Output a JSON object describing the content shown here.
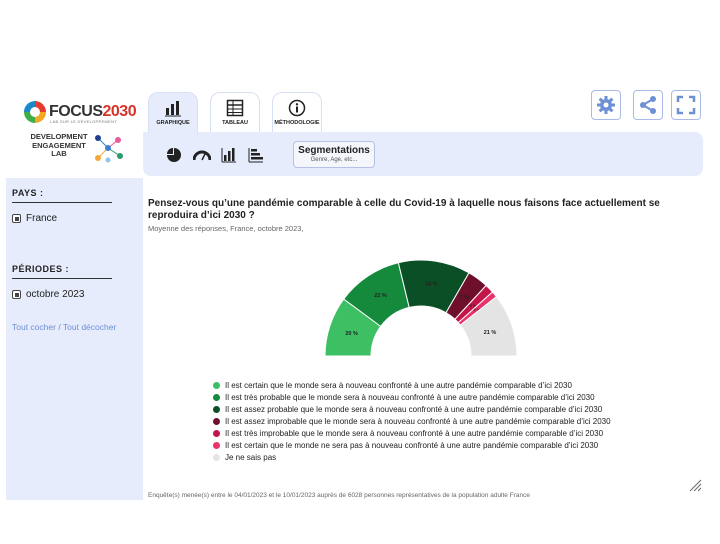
{
  "branding": {
    "focus_text": "FOCUS",
    "focus_year": "2030",
    "focus_tagline": "LAB SUR LE DÉVELOPPEMENT",
    "del_text": "DEVELOPMENT ENGAGEMENT LAB"
  },
  "tabs": [
    {
      "label": "GRAPHIQUE",
      "icon": "bar-chart-icon"
    },
    {
      "label": "TABLEAU",
      "icon": "table-icon"
    },
    {
      "label": "MÉTHODOLOGIE",
      "icon": "info-icon"
    }
  ],
  "tools": {
    "settings": "gear-icon",
    "share": "share-icon",
    "fullscreen": "fullscreen-icon"
  },
  "chart_types": [
    "pie-chart-icon",
    "gauge-icon",
    "bar-chart-icon",
    "stacked-bar-icon"
  ],
  "segmentation": {
    "title": "Segmentations",
    "subtitle": "Genre, Age, etc..."
  },
  "sidebar": {
    "countries_header": "PAYS :",
    "country": "France",
    "periods_header": "PÉRIODES :",
    "period": "octobre 2023",
    "check_all": "Tout cocher",
    "separator": " / ",
    "uncheck_all": "Tout décocher"
  },
  "main": {
    "question": "Pensez-vous qu’une pandémie comparable à celle du Covid-19 à laquelle nous faisons face actuellement se reproduira d’ici 2030 ?",
    "subtitle": "Moyenne des réponses, France, octobre 2023,",
    "footnote": "Enquête(s) menée(s) entre le 04/01/2023 et le 10/01/2023 auprès de 6028 personnes représentatives de la population adulte France"
  },
  "colors": {
    "accent": "#6c8fd6",
    "panel": "#e6ecfb"
  },
  "chart_data": {
    "type": "pie",
    "style": "semicircle",
    "categories": [
      "Il est certain que le monde sera à nouveau confronté à une autre pandémie comparable d’ici 2030",
      "Il est très probable que le monde sera à nouveau confronté à une autre pandémie comparable d’ici 2030",
      "Il est assez probable que le monde sera à nouveau confronté à une autre pandémie comparable d’ici 2030",
      "Il est assez improbable que le monde sera à nouveau confronté à une autre pandémie comparable d’ici 2030",
      "Il est très improbable que le monde sera à nouveau confronté à une autre pandémie comparable d’ici 2030",
      "Il est certain que le monde ne sera pas à nouveau confronté à une autre pandémie comparable d’ici 2030",
      "Je ne sais pas"
    ],
    "values": [
      20,
      22,
      24,
      7,
      3,
      2,
      21
    ],
    "data_labels": [
      "20 %",
      "22 %",
      "24 %",
      "7 %",
      "3 %",
      "2 %",
      "21 %"
    ],
    "colors": [
      "#3dbf63",
      "#158a3c",
      "#0b4f26",
      "#6e0f2c",
      "#c2154a",
      "#e8336b",
      "#e4e4e4"
    ],
    "legend_placement": "bottom"
  }
}
